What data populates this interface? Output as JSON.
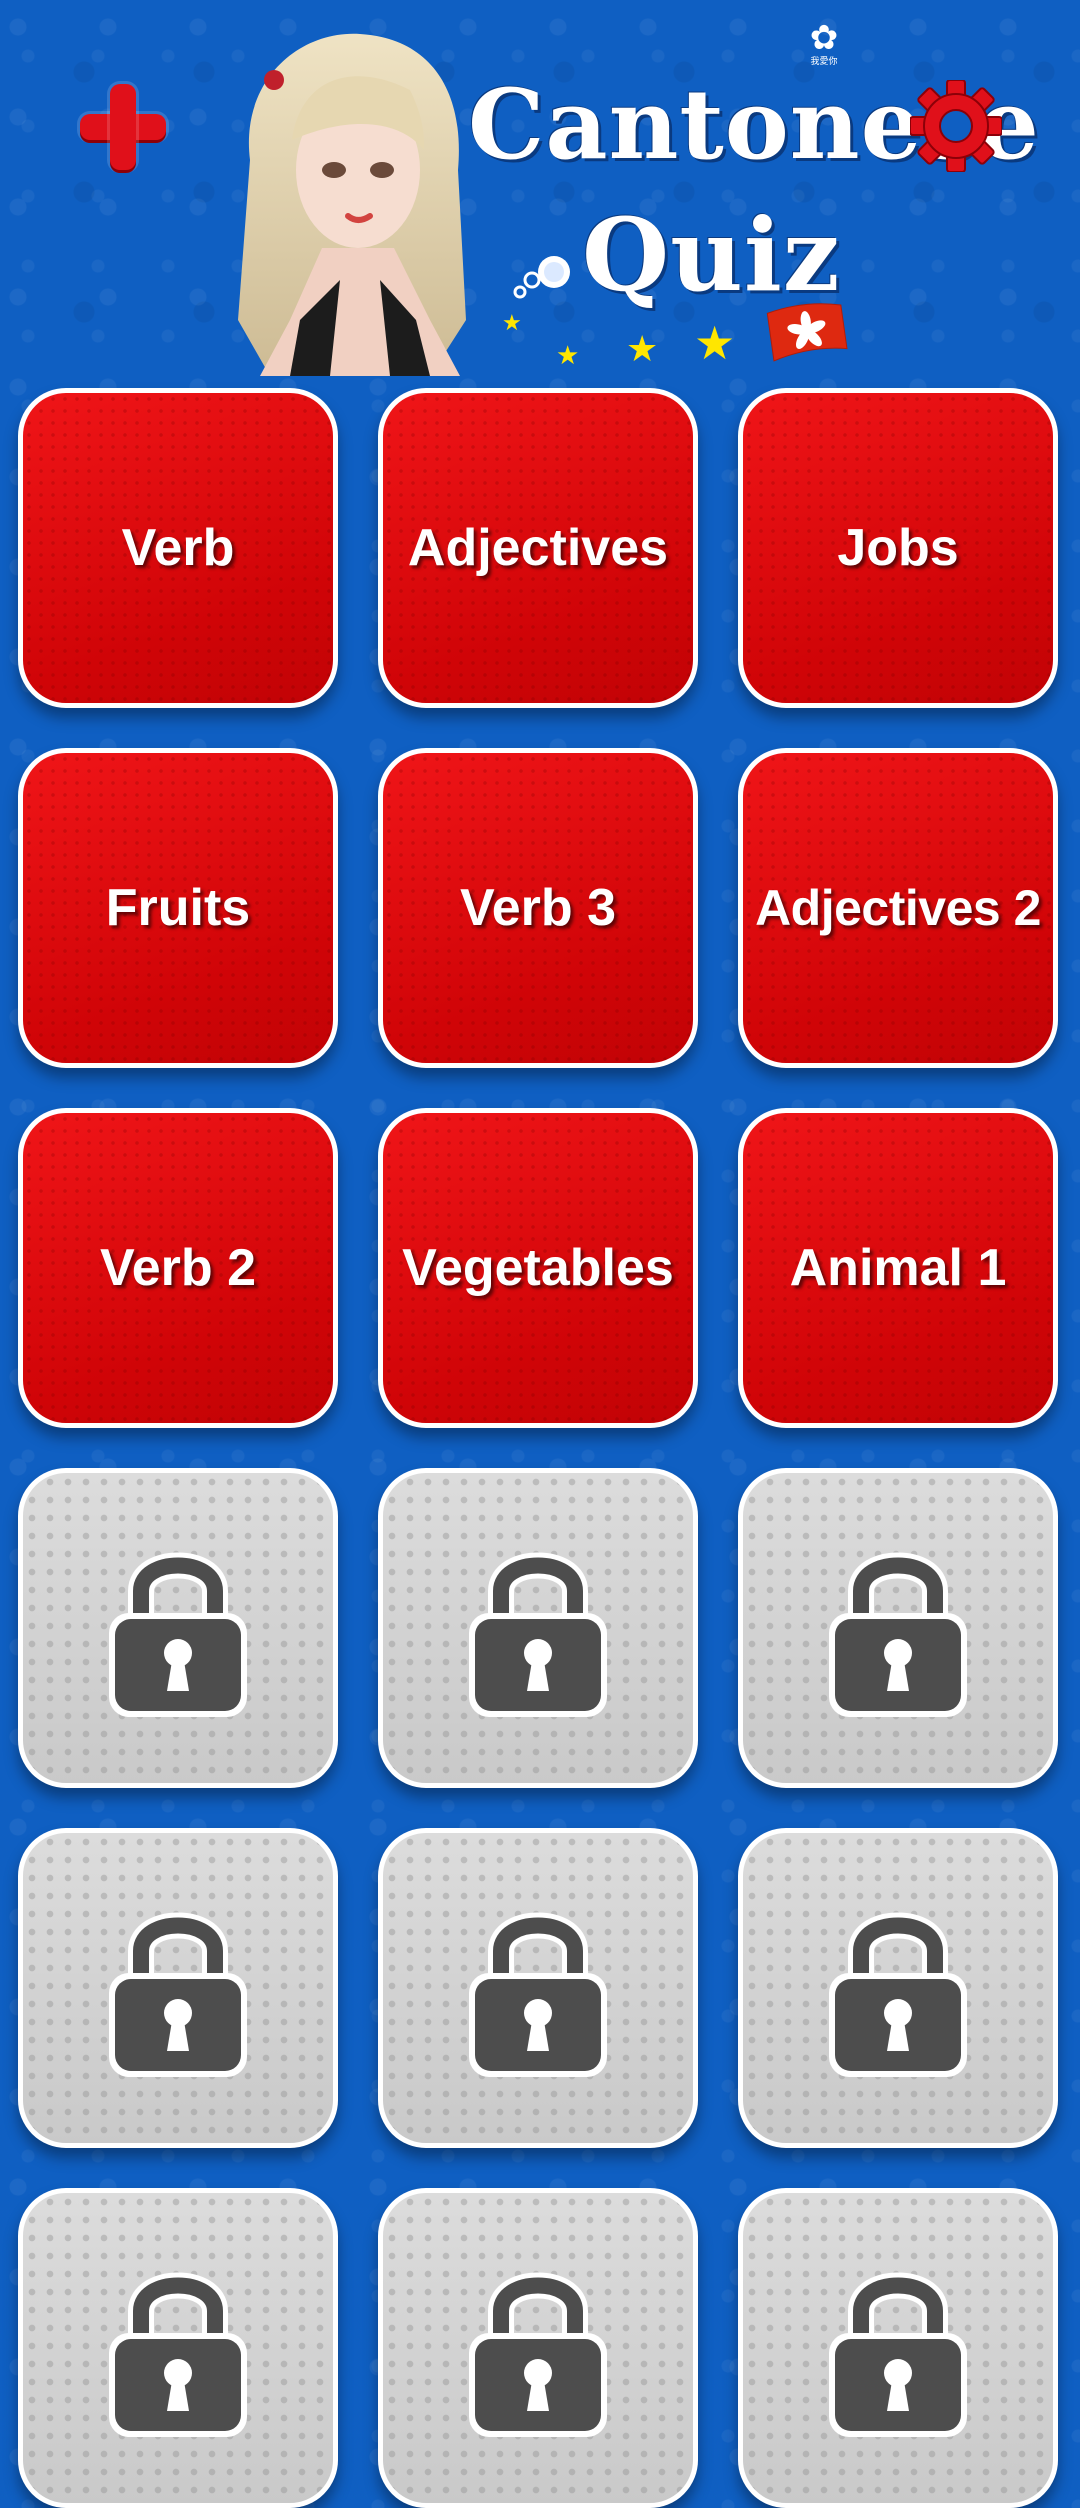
{
  "header": {
    "title_line1": "Cantonese",
    "title_line2": "Quiz",
    "logo_small_text": "我愛你",
    "add_icon": "plus-icon",
    "settings_icon": "gear-icon"
  },
  "categories": [
    {
      "label": "Verb",
      "locked": false
    },
    {
      "label": "Adjectives",
      "locked": false
    },
    {
      "label": "Jobs",
      "locked": false
    },
    {
      "label": "Fruits",
      "locked": false
    },
    {
      "label": "Verb 3",
      "locked": false
    },
    {
      "label": "Adjectives 2",
      "locked": false
    },
    {
      "label": "Verb 2",
      "locked": false
    },
    {
      "label": "Vegetables",
      "locked": false
    },
    {
      "label": "Animal 1",
      "locked": false
    },
    {
      "label": "",
      "locked": true
    },
    {
      "label": "",
      "locked": true
    },
    {
      "label": "",
      "locked": true
    },
    {
      "label": "",
      "locked": true
    },
    {
      "label": "",
      "locked": true
    },
    {
      "label": "",
      "locked": true
    },
    {
      "label": "",
      "locked": true
    },
    {
      "label": "",
      "locked": true
    },
    {
      "label": "",
      "locked": true
    }
  ],
  "colors": {
    "background": "#0f5fc2",
    "tile_open": "#e20a0c",
    "tile_locked": "#d4d4d4",
    "lock": "#4d4d4d",
    "accent_red": "#e0101a",
    "star": "#ffe600"
  }
}
